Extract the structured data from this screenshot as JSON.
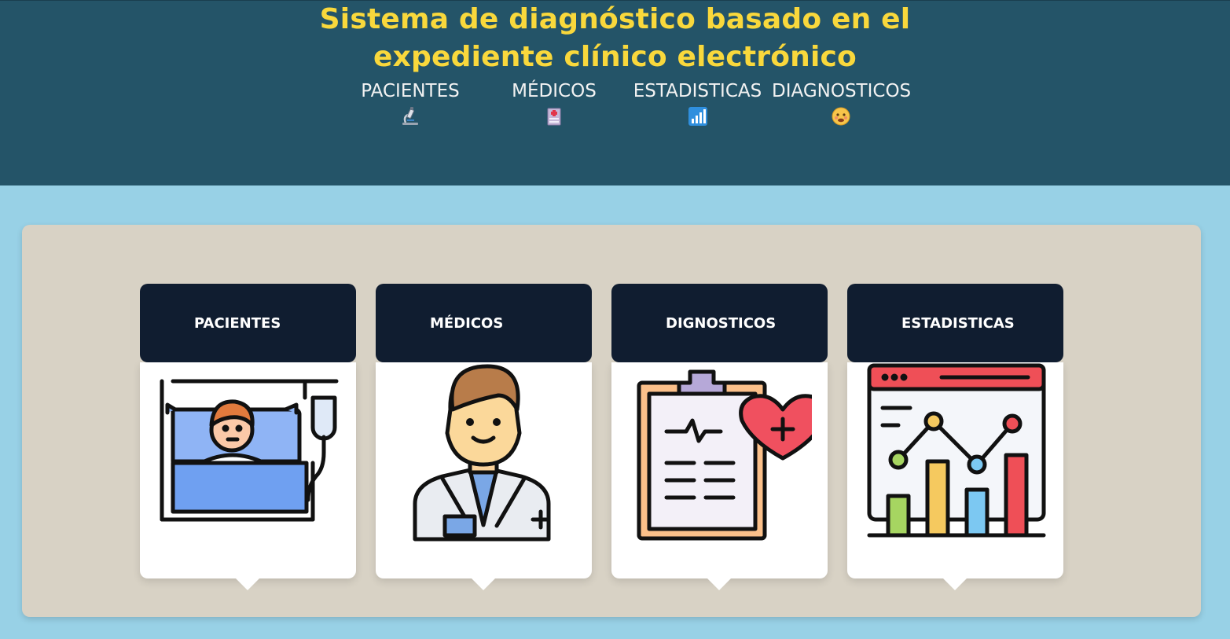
{
  "header": {
    "title_line1": "Sistema de diagnóstico basado en el",
    "title_line2": "expediente clínico electrónico"
  },
  "nav": [
    {
      "label": "PACIENTES",
      "icon": "microscope-icon"
    },
    {
      "label": "MÉDICOS",
      "icon": "hospital-icon"
    },
    {
      "label": "ESTADISTICAS",
      "icon": "bar-chart-icon"
    },
    {
      "label": "DIAGNOSTICOS",
      "icon": "sick-face-icon"
    }
  ],
  "cards": [
    {
      "label": "PACIENTES",
      "icon": "patient-in-bed-icon"
    },
    {
      "label": "MÉDICOS",
      "icon": "doctor-icon"
    },
    {
      "label": "DIGNOSTICOS",
      "icon": "clipboard-heart-icon"
    },
    {
      "label": "ESTADISTICAS",
      "icon": "statistics-chart-icon"
    }
  ],
  "colors": {
    "header_bg": "#245468",
    "title": "#f9d83c",
    "page_bg": "#98d1e6",
    "panel_bg": "#d8d2c5",
    "card_head": "#101d30"
  }
}
